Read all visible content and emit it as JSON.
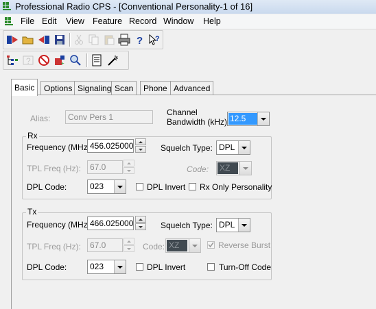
{
  "window": {
    "title": "Professional Radio CPS - [Conventional Personality-1 of 16]"
  },
  "menu": [
    "File",
    "Edit",
    "View",
    "Feature",
    "Record",
    "Window",
    "Help"
  ],
  "toolbar1_icons": [
    "open-codeplug-icon",
    "open-folder-icon",
    "read-radio-icon",
    "save-icon",
    "cut-icon",
    "copy-icon",
    "paste-icon",
    "print-icon",
    "help-icon",
    "context-help-icon"
  ],
  "toolbar2_icons": [
    "tree-view-icon",
    "help-disabled-icon",
    "no-entry-icon",
    "add-record-icon",
    "find-icon",
    "notes-icon",
    "wizard-icon"
  ],
  "tabs": [
    "Basic",
    "Options",
    "Signaling",
    "Scan",
    "Phone",
    "Advanced"
  ],
  "active_tab": "Basic",
  "basic": {
    "alias_label": "Alias:",
    "alias_value": "Conv Pers 1",
    "channel_bw_label_1": "Channel",
    "channel_bw_label_2": "Bandwidth (kHz):",
    "channel_bw_value": "12.5"
  },
  "rx": {
    "legend": "Rx",
    "frequency_label": "Frequency (MHz):",
    "frequency_value": "456.025000",
    "squelch_label": "Squelch Type:",
    "squelch_value": "DPL",
    "tpl_label": "TPL Freq (Hz):",
    "tpl_value": "67.0",
    "code_label": "Code:",
    "code_value": "XZ",
    "dpl_code_label": "DPL Code:",
    "dpl_code_value": "023",
    "dpl_invert_label": "DPL Invert",
    "rx_only_label": "Rx Only Personality"
  },
  "tx": {
    "legend": "Tx",
    "frequency_label": "Frequency (MHz):",
    "frequency_value": "466.025000",
    "squelch_label": "Squelch Type:",
    "squelch_value": "DPL",
    "tpl_label": "TPL Freq (Hz):",
    "tpl_value": "67.0",
    "code_label": "Code:",
    "code_value": "XZ",
    "reverse_burst_label": "Reverse Burst",
    "reverse_burst_checked": true,
    "dpl_code_label": "DPL Code:",
    "dpl_code_value": "023",
    "dpl_invert_label": "DPL Invert",
    "turnoff_label": "Turn-Off Code"
  }
}
